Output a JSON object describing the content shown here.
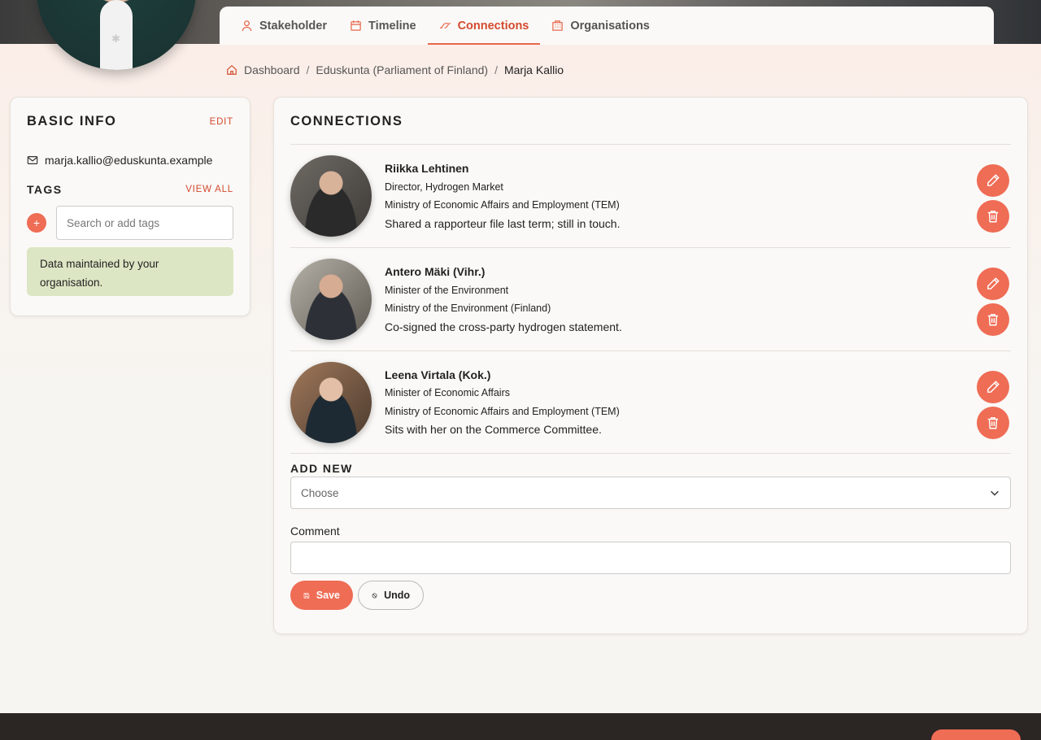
{
  "tabs": [
    {
      "label": "Stakeholder",
      "icon": "user-icon",
      "active": false
    },
    {
      "label": "Timeline",
      "icon": "calendar-icon",
      "active": false
    },
    {
      "label": "Connections",
      "icon": "connections-icon",
      "active": true
    },
    {
      "label": "Organisations",
      "icon": "building-icon",
      "active": false
    }
  ],
  "breadcrumb": {
    "home": "Dashboard",
    "parent": "Eduskunta (Parliament of Finland)",
    "current": "Marja Kallio"
  },
  "basic_info": {
    "title": "BASIC INFO",
    "edit_label": "EDIT",
    "email": "marja.kallio@eduskunta.example",
    "tags_title": "TAGS",
    "view_all_label": "VIEW ALL",
    "tag_placeholder": "Search or add tags",
    "notice": "Data maintained by your organisation."
  },
  "connections": {
    "title": "CONNECTIONS",
    "items": [
      {
        "name": "Riikka Lehtinen",
        "role": "Director, Hydrogen Market",
        "organisation": "Ministry of Economic Affairs and Employment (TEM)",
        "comment": "Shared a rapporteur file last term; still in touch."
      },
      {
        "name": "Antero Mäki (Vihr.)",
        "role": "Minister of the Environment",
        "organisation": "Ministry of the Environment (Finland)",
        "comment": "Co-signed the cross-party hydrogen statement."
      },
      {
        "name": "Leena Virtala (Kok.)",
        "role": "Minister of Economic Affairs",
        "organisation": "Ministry of Economic Affairs and Employment (TEM)",
        "comment": "Sits with her on the Commerce Committee."
      }
    ],
    "add_new_title": "ADD NEW",
    "select_value": "Choose",
    "comment_label": "Comment",
    "comment_value": "",
    "save_label": "Save",
    "undo_label": "Undo"
  },
  "colors": {
    "accent": "#ef6c55",
    "accent_text": "#d34a2e",
    "notice_bg": "#dde6c4",
    "footer_bg": "#2b2523"
  }
}
